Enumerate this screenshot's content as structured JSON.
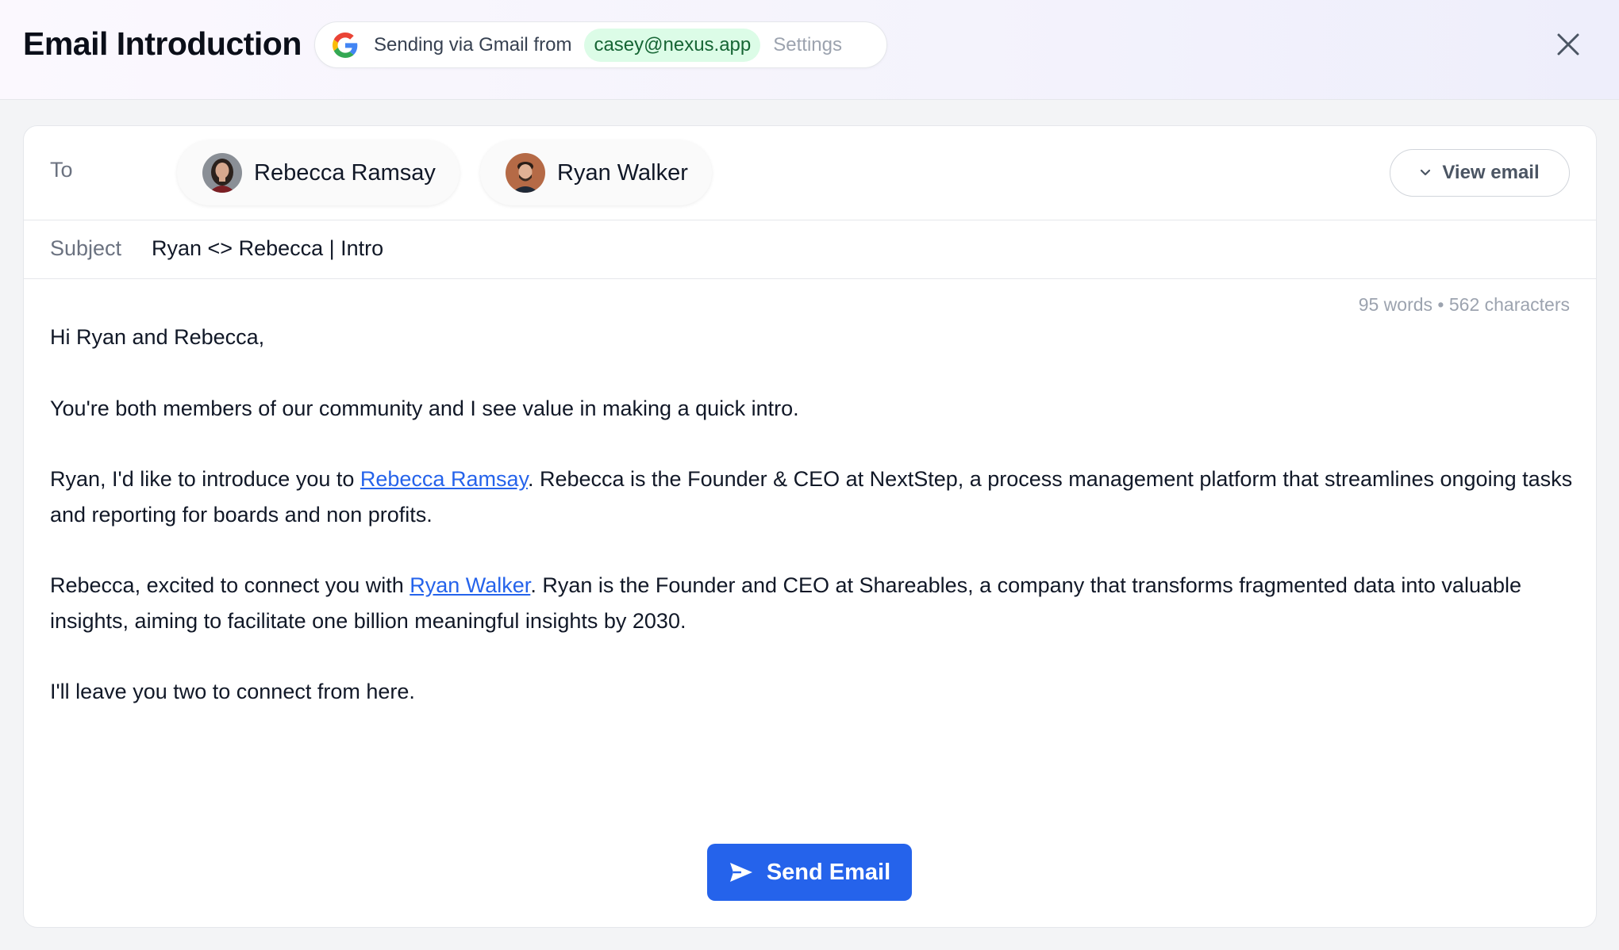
{
  "header": {
    "title": "Email Introduction",
    "sending_via": "Sending via Gmail from",
    "sender_email": "casey@nexus.app",
    "settings_label": "Settings",
    "close_icon": "close-icon"
  },
  "recipients": {
    "to_label": "To",
    "items": [
      {
        "name": "Rebecca Ramsay",
        "avatar": "avatar-photo"
      },
      {
        "name": "Ryan Walker",
        "avatar": "avatar-photo"
      }
    ],
    "view_email_label": "View email"
  },
  "subject": {
    "label": "Subject",
    "value": "Ryan <> Rebecca | Intro"
  },
  "counter": "95 words • 562 characters",
  "body": {
    "greeting": "Hi Ryan and Rebecca,",
    "p1": "You're both members of our community and I see value in making a quick intro.",
    "p2_pre": "Ryan, I'd like to introduce you to ",
    "p2_link": "Rebecca Ramsay",
    "p2_post": ". Rebecca is the Founder & CEO at NextStep, a process management platform that streamlines ongoing tasks and reporting for boards and non profits.",
    "p3_pre": "Rebecca, excited to connect you with ",
    "p3_link": "Ryan Walker",
    "p3_post": ". Ryan is the Founder and CEO at Shareables, a company that transforms fragmented data into valuable insights, aiming to facilitate one billion meaningful insights by 2030.",
    "closing": "I'll leave you two to connect from here."
  },
  "send_button_label": "Send Email",
  "colors": {
    "accent": "#2563eb",
    "email_chip_bg": "#dcfce7",
    "email_chip_text": "#166534"
  }
}
